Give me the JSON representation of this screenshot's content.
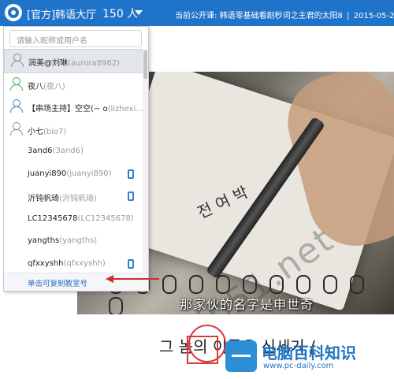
{
  "header": {
    "room_title": "[官方]韩语大厅",
    "count": "150 人",
    "ticker_label": "当前公开课:",
    "ticker_course": "韩语零基础看剧秒词之主君的太阳8",
    "ticker_sep": "|",
    "ticker_date": "2015-05-21 20"
  },
  "panel": {
    "search_placeholder": "请输入昵称或用户名",
    "users": [
      {
        "name": "润美@刘琳",
        "uid": "(aurora8982)",
        "avatar": "gray",
        "selected": true,
        "mobile": false
      },
      {
        "name": "夜八",
        "uid": "(夜八)",
        "avatar": "green",
        "selected": false,
        "mobile": false
      },
      {
        "name": "【串场主持】空空(~ o",
        "uid": "(lizhexi...",
        "avatar": "blue",
        "selected": false,
        "mobile": false
      },
      {
        "name": "小七",
        "uid": "(bio7)",
        "avatar": "gray",
        "selected": false,
        "mobile": false
      },
      {
        "name": "3and6",
        "uid": "(3and6)",
        "avatar": "none",
        "selected": false,
        "mobile": false
      },
      {
        "name": "juanyi890",
        "uid": "(juanyi890)",
        "avatar": "none",
        "selected": false,
        "mobile": true
      },
      {
        "name": "沂钝帆琦",
        "uid": "(沂钝帆琦)",
        "avatar": "none",
        "selected": false,
        "mobile": true
      },
      {
        "name": "LC12345678",
        "uid": "(LC12345678)",
        "avatar": "none",
        "selected": false,
        "mobile": false
      },
      {
        "name": "yangths",
        "uid": "(yangths)",
        "avatar": "none",
        "selected": false,
        "mobile": false
      },
      {
        "name": "qfxxyshh",
        "uid": "(qfxxyshh)",
        "avatar": "none",
        "selected": false,
        "mobile": true
      }
    ],
    "footer": "单击可复制教室号"
  },
  "video": {
    "subtitle": "那家伙的名字是申世奇",
    "scribble": "전 여 박",
    "korean": "그 놈의 이름은 신세기 /",
    "watermark": "jb51.net"
  },
  "brand": {
    "name": "电脑百科知识",
    "url": "www.pc-daily.com"
  },
  "colors": {
    "topbar": "#1f73c9",
    "highlight": "#d62b2b"
  }
}
